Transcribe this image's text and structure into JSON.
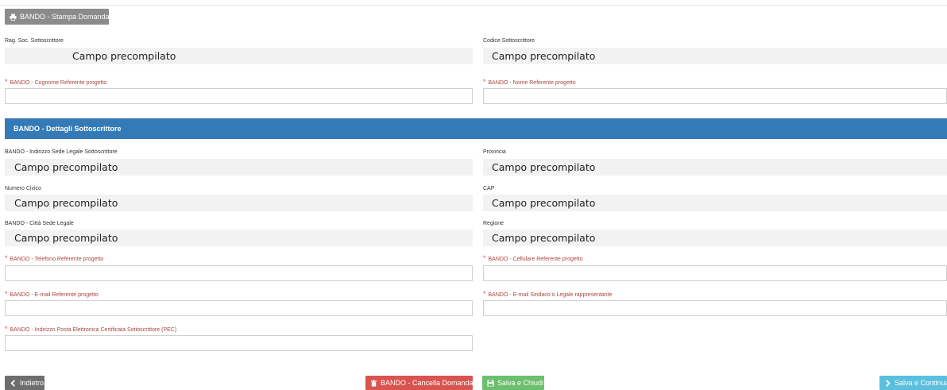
{
  "buttons": {
    "print": "BANDO - Stampa Domanda",
    "back": "Indietro",
    "cancel": "BANDO - Cancella Domanda",
    "save_close": "Salva e Chiudi",
    "save_continue": "Salva e Continua"
  },
  "fields": {
    "rag_soc": {
      "label": "Rag. Soc. Sottoscrittore",
      "value": "Campo precompilato"
    },
    "codice": {
      "label": "Codice Sottoscrittore",
      "value": "Campo precompilato"
    },
    "cognome": {
      "label": "BANDO - Cognome Referente progetto",
      "value": ""
    },
    "nome": {
      "label": "BANDO - Nome Referente progetto",
      "value": ""
    },
    "indirizzo": {
      "label": "BANDO - Indirizzo Sede Legale Sottoscrittore",
      "value": "Campo precompilato"
    },
    "provincia": {
      "label": "Provincia",
      "value": "Campo precompilato"
    },
    "civico": {
      "label": "Numero Civico",
      "value": "Campo precompilato"
    },
    "cap": {
      "label": "CAP",
      "value": "Campo precompilato"
    },
    "citta": {
      "label": "BANDO - Città Sede Legale",
      "value": "Campo precompilato"
    },
    "regione": {
      "label": "Regione",
      "value": "Campo precompilato"
    },
    "telefono": {
      "label": "BANDO - Telefono Referente progetto",
      "value": ""
    },
    "cellulare": {
      "label": "BANDO - Cellulare Referente progetto",
      "value": ""
    },
    "email_ref": {
      "label": "BANDO - E-mail Referente progetto",
      "value": ""
    },
    "email_sindaco": {
      "label": "BANDO - E-mail Sindaco o Legale rappresentante",
      "value": ""
    },
    "pec": {
      "label": "BANDO - Indirizzo Posta Elettronica Certificata Sottoscrittore (PEC)",
      "value": ""
    }
  },
  "section": {
    "title": "BANDO - Dettagli Sottoscrittore"
  },
  "required_marker": "*",
  "colors": {
    "section_header": "#337ab7",
    "print_button": "#8b8b8b",
    "back_button": "#6e6e6e",
    "cancel_button": "#d9534f",
    "save_button": "#6cbf6c",
    "continue_button": "#5bc0de",
    "required_label": "#a94442"
  },
  "icons": {
    "print": "print-icon",
    "back": "chevron-left-icon",
    "cancel": "trash-icon",
    "save": "floppy-disk-icon",
    "continue": "chevron-right-icon"
  }
}
